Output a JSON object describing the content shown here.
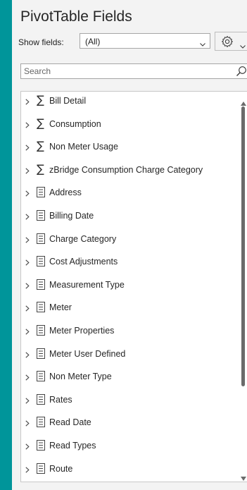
{
  "header": {
    "title": "PivotTable Fields"
  },
  "show_fields": {
    "label": "Show fields:",
    "value": "(All)"
  },
  "settings": {
    "icon": "gear-icon"
  },
  "search": {
    "placeholder": "Search"
  },
  "fields": [
    {
      "type": "measure",
      "label": "Bill Detail"
    },
    {
      "type": "measure",
      "label": "Consumption"
    },
    {
      "type": "measure",
      "label": "Non Meter Usage"
    },
    {
      "type": "measure",
      "label": "zBridge Consumption Charge Category"
    },
    {
      "type": "table",
      "label": "Address"
    },
    {
      "type": "table",
      "label": "Billing Date"
    },
    {
      "type": "table",
      "label": "Charge Category"
    },
    {
      "type": "table",
      "label": "Cost Adjustments"
    },
    {
      "type": "table",
      "label": "Measurement Type"
    },
    {
      "type": "table",
      "label": "Meter"
    },
    {
      "type": "table",
      "label": "Meter Properties"
    },
    {
      "type": "table",
      "label": "Meter User Defined"
    },
    {
      "type": "table",
      "label": "Non Meter Type"
    },
    {
      "type": "table",
      "label": "Rates"
    },
    {
      "type": "table",
      "label": "Read Date"
    },
    {
      "type": "table",
      "label": "Read Types"
    },
    {
      "type": "table",
      "label": "Route"
    }
  ],
  "colors": {
    "background": "#00959a",
    "panel": "#f3f3f3",
    "text": "#262626"
  }
}
